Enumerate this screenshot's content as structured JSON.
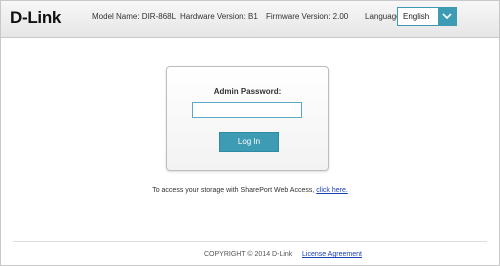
{
  "header": {
    "logo": "D-Link",
    "model_name": "Model Name: DIR-868L",
    "hardware_version": "Hardware Version: B1",
    "firmware_version": "Firmware Version: 2.00",
    "language_label": "Language:",
    "language_value": "English"
  },
  "login": {
    "password_label": "Admin Password:",
    "password_value": "",
    "button_label": "Log In"
  },
  "shareport": {
    "text": "To access your storage with SharePort Web Access, ",
    "link": "click here."
  },
  "footer": {
    "copyright": "COPYRIGHT © 2014 D-Link",
    "license": "License Agreement"
  },
  "colors": {
    "accent": "#3e9bb4",
    "link": "#1a3fb0"
  }
}
